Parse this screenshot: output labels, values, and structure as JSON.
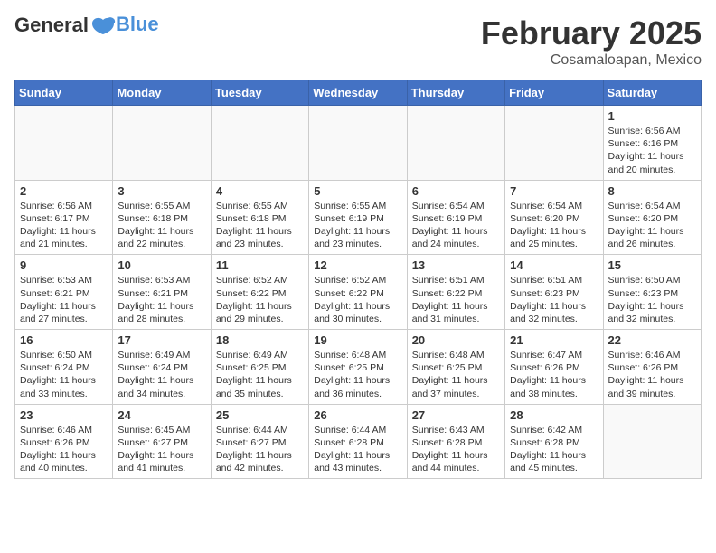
{
  "header": {
    "logo_line1": "General",
    "logo_line2": "Blue",
    "month_title": "February 2025",
    "location": "Cosamaloapan, Mexico"
  },
  "weekdays": [
    "Sunday",
    "Monday",
    "Tuesday",
    "Wednesday",
    "Thursday",
    "Friday",
    "Saturday"
  ],
  "weeks": [
    [
      {
        "day": "",
        "info": ""
      },
      {
        "day": "",
        "info": ""
      },
      {
        "day": "",
        "info": ""
      },
      {
        "day": "",
        "info": ""
      },
      {
        "day": "",
        "info": ""
      },
      {
        "day": "",
        "info": ""
      },
      {
        "day": "1",
        "info": "Sunrise: 6:56 AM\nSunset: 6:16 PM\nDaylight: 11 hours and 20 minutes."
      }
    ],
    [
      {
        "day": "2",
        "info": "Sunrise: 6:56 AM\nSunset: 6:17 PM\nDaylight: 11 hours and 21 minutes."
      },
      {
        "day": "3",
        "info": "Sunrise: 6:55 AM\nSunset: 6:18 PM\nDaylight: 11 hours and 22 minutes."
      },
      {
        "day": "4",
        "info": "Sunrise: 6:55 AM\nSunset: 6:18 PM\nDaylight: 11 hours and 23 minutes."
      },
      {
        "day": "5",
        "info": "Sunrise: 6:55 AM\nSunset: 6:19 PM\nDaylight: 11 hours and 23 minutes."
      },
      {
        "day": "6",
        "info": "Sunrise: 6:54 AM\nSunset: 6:19 PM\nDaylight: 11 hours and 24 minutes."
      },
      {
        "day": "7",
        "info": "Sunrise: 6:54 AM\nSunset: 6:20 PM\nDaylight: 11 hours and 25 minutes."
      },
      {
        "day": "8",
        "info": "Sunrise: 6:54 AM\nSunset: 6:20 PM\nDaylight: 11 hours and 26 minutes."
      }
    ],
    [
      {
        "day": "9",
        "info": "Sunrise: 6:53 AM\nSunset: 6:21 PM\nDaylight: 11 hours and 27 minutes."
      },
      {
        "day": "10",
        "info": "Sunrise: 6:53 AM\nSunset: 6:21 PM\nDaylight: 11 hours and 28 minutes."
      },
      {
        "day": "11",
        "info": "Sunrise: 6:52 AM\nSunset: 6:22 PM\nDaylight: 11 hours and 29 minutes."
      },
      {
        "day": "12",
        "info": "Sunrise: 6:52 AM\nSunset: 6:22 PM\nDaylight: 11 hours and 30 minutes."
      },
      {
        "day": "13",
        "info": "Sunrise: 6:51 AM\nSunset: 6:22 PM\nDaylight: 11 hours and 31 minutes."
      },
      {
        "day": "14",
        "info": "Sunrise: 6:51 AM\nSunset: 6:23 PM\nDaylight: 11 hours and 32 minutes."
      },
      {
        "day": "15",
        "info": "Sunrise: 6:50 AM\nSunset: 6:23 PM\nDaylight: 11 hours and 32 minutes."
      }
    ],
    [
      {
        "day": "16",
        "info": "Sunrise: 6:50 AM\nSunset: 6:24 PM\nDaylight: 11 hours and 33 minutes."
      },
      {
        "day": "17",
        "info": "Sunrise: 6:49 AM\nSunset: 6:24 PM\nDaylight: 11 hours and 34 minutes."
      },
      {
        "day": "18",
        "info": "Sunrise: 6:49 AM\nSunset: 6:25 PM\nDaylight: 11 hours and 35 minutes."
      },
      {
        "day": "19",
        "info": "Sunrise: 6:48 AM\nSunset: 6:25 PM\nDaylight: 11 hours and 36 minutes."
      },
      {
        "day": "20",
        "info": "Sunrise: 6:48 AM\nSunset: 6:25 PM\nDaylight: 11 hours and 37 minutes."
      },
      {
        "day": "21",
        "info": "Sunrise: 6:47 AM\nSunset: 6:26 PM\nDaylight: 11 hours and 38 minutes."
      },
      {
        "day": "22",
        "info": "Sunrise: 6:46 AM\nSunset: 6:26 PM\nDaylight: 11 hours and 39 minutes."
      }
    ],
    [
      {
        "day": "23",
        "info": "Sunrise: 6:46 AM\nSunset: 6:26 PM\nDaylight: 11 hours and 40 minutes."
      },
      {
        "day": "24",
        "info": "Sunrise: 6:45 AM\nSunset: 6:27 PM\nDaylight: 11 hours and 41 minutes."
      },
      {
        "day": "25",
        "info": "Sunrise: 6:44 AM\nSunset: 6:27 PM\nDaylight: 11 hours and 42 minutes."
      },
      {
        "day": "26",
        "info": "Sunrise: 6:44 AM\nSunset: 6:28 PM\nDaylight: 11 hours and 43 minutes."
      },
      {
        "day": "27",
        "info": "Sunrise: 6:43 AM\nSunset: 6:28 PM\nDaylight: 11 hours and 44 minutes."
      },
      {
        "day": "28",
        "info": "Sunrise: 6:42 AM\nSunset: 6:28 PM\nDaylight: 11 hours and 45 minutes."
      },
      {
        "day": "",
        "info": ""
      }
    ]
  ]
}
